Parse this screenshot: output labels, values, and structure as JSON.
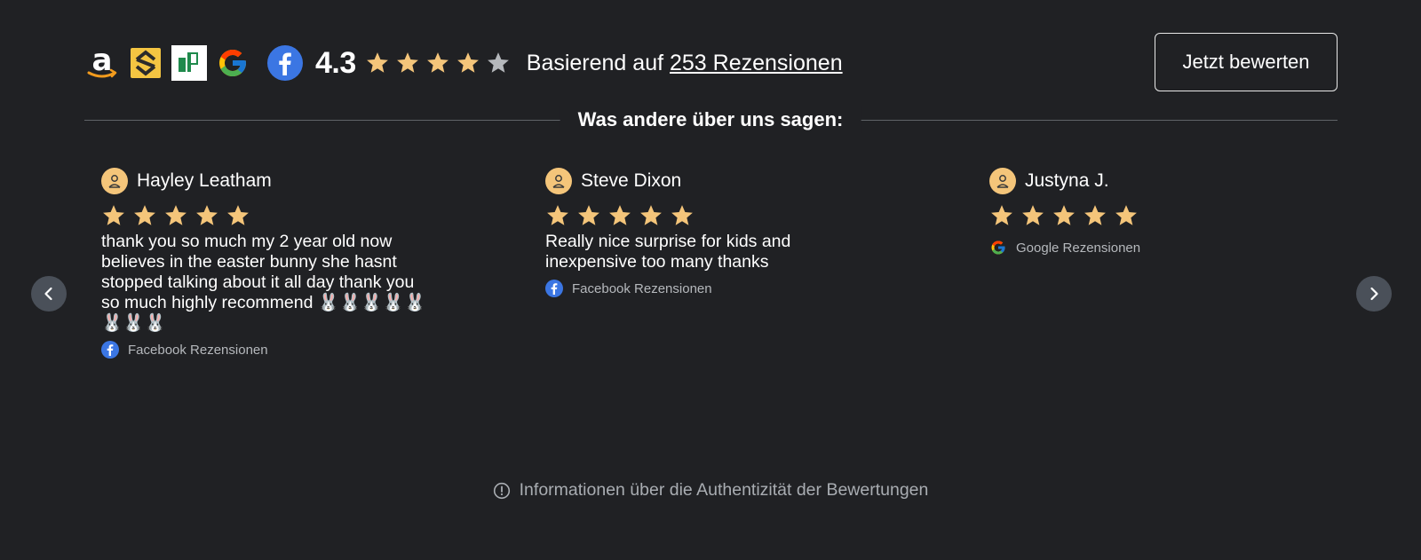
{
  "header": {
    "platforms": [
      {
        "name": "Amazon",
        "icon": "amazon-icon"
      },
      {
        "name": "Trustpilot-like",
        "icon": "reviews-s-icon"
      },
      {
        "name": "Yell",
        "icon": "yell-icon"
      },
      {
        "name": "Google",
        "icon": "google-icon"
      },
      {
        "name": "Facebook",
        "icon": "facebook-icon"
      }
    ],
    "rating": "4.3",
    "rating_stars": 4.3,
    "based_on_prefix": "Basierend auf",
    "review_count_link": "253 Rezensionen",
    "rate_button": "Jetzt bewerten"
  },
  "section_title": "Was andere über uns sagen:",
  "reviews": [
    {
      "name": "Hayley Leatham",
      "stars": 5,
      "text": "thank you so much my 2 year old now believes in the easter bunny she hasnt stopped talking about it all day thank you so much highly recommend 🐰🐰🐰🐰🐰🐰🐰🐰",
      "source": "Facebook Rezensionen",
      "source_icon": "facebook-icon"
    },
    {
      "name": "Steve Dixon",
      "stars": 5,
      "text": "Really nice surprise for kids and inexpensive too many thanks",
      "source": "Facebook Rezensionen",
      "source_icon": "facebook-icon"
    },
    {
      "name": "Justyna J.",
      "stars": 5,
      "text": "",
      "source": "Google Rezensionen",
      "source_icon": "google-icon"
    }
  ],
  "footer": {
    "info_text": "Informationen über die Authentizität der Bewertungen",
    "icon": "info-icon"
  },
  "colors": {
    "background": "#202124",
    "star_filled": "#f4c57a",
    "star_empty": "#b5b8bc",
    "avatar": "#f4c57a",
    "nav_button": "#4a5059",
    "facebook_blue": "#3b76e3"
  }
}
